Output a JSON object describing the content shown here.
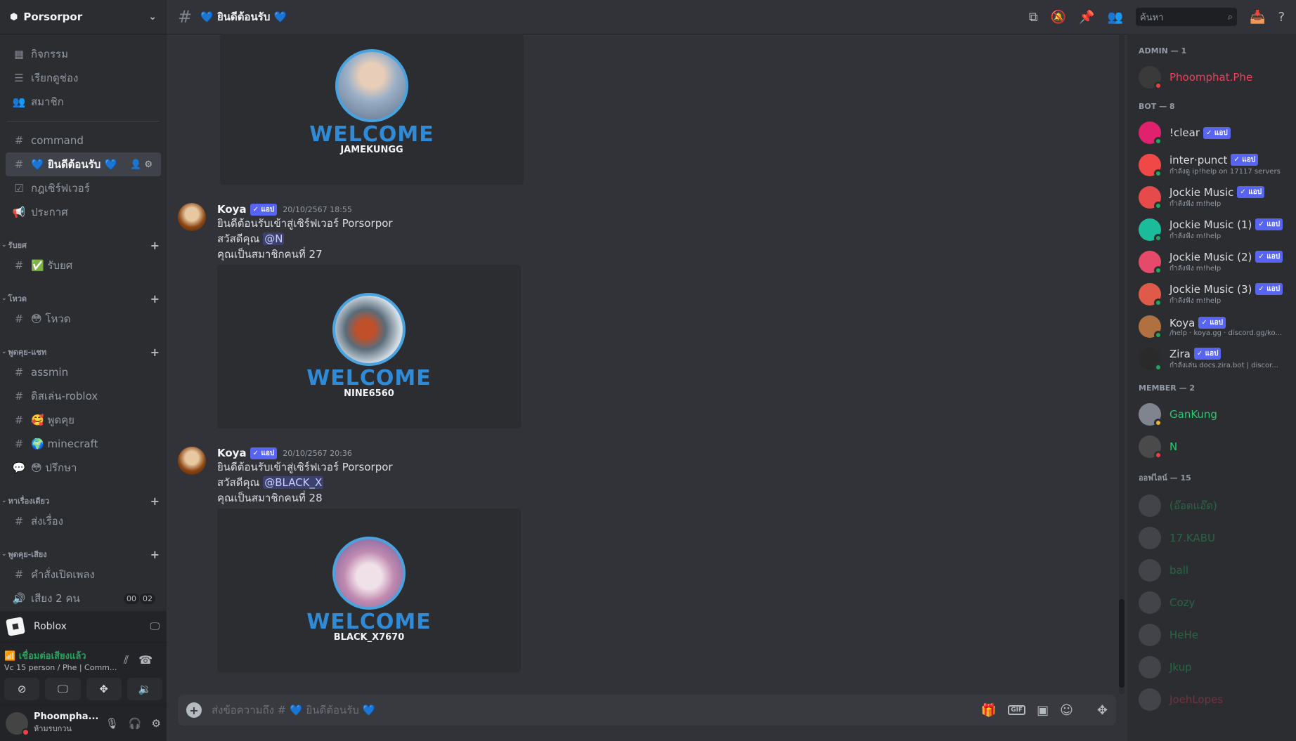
{
  "server": {
    "name": "Porsorpor"
  },
  "nav": [
    {
      "icon": "calendar-icon",
      "label": "กิจกรรม"
    },
    {
      "icon": "browse-channels-icon",
      "label": "เรียกดูช่อง"
    },
    {
      "icon": "members-icon",
      "label": "สมาชิก"
    }
  ],
  "channels_top": [
    {
      "label": "command"
    },
    {
      "label": "💙 ยินดีต้อนรับ 💙",
      "active": true
    },
    {
      "label": "กฎเซิร์ฟเวอร์"
    },
    {
      "label": "ประกาศ"
    }
  ],
  "categories": [
    {
      "name": "รับยศ",
      "channels": [
        "✅ รับยศ"
      ]
    },
    {
      "name": "โหวด",
      "channels": [
        "😳 โหวด"
      ]
    },
    {
      "name": "พูดคุย-แชท",
      "channels": [
        "assmin",
        "ดิสเล่น-roblox",
        "🥰 พูดคุย",
        "🌍 minecraft",
        "😳 ปรึกษา"
      ]
    },
    {
      "name": "หาเรื่องเดียว",
      "channels": [
        "ส่งเรื่อง"
      ]
    },
    {
      "name": "พูดคุย-เสียง",
      "channels": [
        "คำสั่งเปิดเพลง",
        "เสียง 2 คน"
      ]
    }
  ],
  "voice_count": [
    "00",
    "02"
  ],
  "activity": {
    "label": "Roblox"
  },
  "voice": {
    "status": "เชื่อมต่อเสียงแล้ว",
    "channel": "Vc 15 person / Phe | Comm..."
  },
  "user": {
    "name": "Phoompha...",
    "status": "ห้ามรบกวน"
  },
  "topbar": {
    "title": "💙 ยินดีต้อนรับ 💙",
    "search_placeholder": "ค้นหา"
  },
  "messages": [
    {
      "card_title": "WELCOME",
      "card_name": "JAMEKUNGG"
    },
    {
      "author": "Koya",
      "tag": "✓ แอป",
      "time": "20/10/2567 18:55",
      "line1": "ยินดีต้อนรับเข้าสู่เซิร์ฟเวอร์ Porsorpor",
      "line2_prefix": "สวัสดีคุณ",
      "mention": "@N",
      "line3": "คุณเป็นสมาชิกคนที่ 27",
      "card_title": "WELCOME",
      "card_name": "NINE6560"
    },
    {
      "author": "Koya",
      "tag": "✓ แอป",
      "time": "20/10/2567 20:36",
      "line1": "ยินดีต้อนรับเข้าสู่เซิร์ฟเวอร์ Porsorpor",
      "line2_prefix": "สวัสดีคุณ",
      "mention": "@BLACK_X",
      "line3": "คุณเป็นสมาชิกคนที่ 28",
      "card_title": "WELCOME",
      "card_name": "BLACK_X7670"
    }
  ],
  "composer": {
    "placeholder": "ส่งข้อความถึง # 💙 ยินดีต้อนรับ 💙"
  },
  "members": {
    "groups": [
      {
        "title": "ADMIN — 1",
        "items": [
          {
            "name": "Phoomphat.Phe",
            "color": "#f23f5c"
          }
        ]
      },
      {
        "title": "BOT — 8",
        "items": [
          {
            "name": "!clear",
            "tag": "✓ แอป"
          },
          {
            "name": "inter·punct",
            "tag": "✓ แอป",
            "sub": "กำลังดู ip!help on 17117 servers"
          },
          {
            "name": "Jockie Music",
            "tag": "✓ แอป",
            "sub": "กำลังฟัง m!help"
          },
          {
            "name": "Jockie Music (1)",
            "tag": "✓ แอป",
            "sub": "กำลังฟัง m!help"
          },
          {
            "name": "Jockie Music (2)",
            "tag": "✓ แอป",
            "sub": "กำลังฟัง m!help"
          },
          {
            "name": "Jockie Music (3)",
            "tag": "✓ แอป",
            "sub": "กำลังฟัง m!help"
          },
          {
            "name": "Koya",
            "tag": "✓ แอป",
            "sub": "/help · koya.gg · discord.gg/ko..."
          },
          {
            "name": "Zira",
            "tag": "✓ แอป",
            "sub": "กำลังเล่น docs.zira.bot | discor..."
          }
        ]
      },
      {
        "title": "MEMBER — 2",
        "items": [
          {
            "name": "GanKung",
            "color": "#2dc770"
          },
          {
            "name": "N",
            "color": "#2dc770"
          }
        ]
      },
      {
        "title": "ออฟไลน์ — 15",
        "items": [
          {
            "name": "(อ๊อดแอ๊ด)",
            "color": "#2dc770"
          },
          {
            "name": "17.KABU",
            "color": "#2dc770"
          },
          {
            "name": "ball",
            "color": "#2dc770"
          },
          {
            "name": "Cozy",
            "color": "#2dc770"
          },
          {
            "name": "HeHe",
            "color": "#2dc770"
          },
          {
            "name": "Jkup",
            "color": "#2dc770"
          },
          {
            "name": "JoehLopes",
            "color": "#f23f5c"
          }
        ]
      }
    ]
  }
}
